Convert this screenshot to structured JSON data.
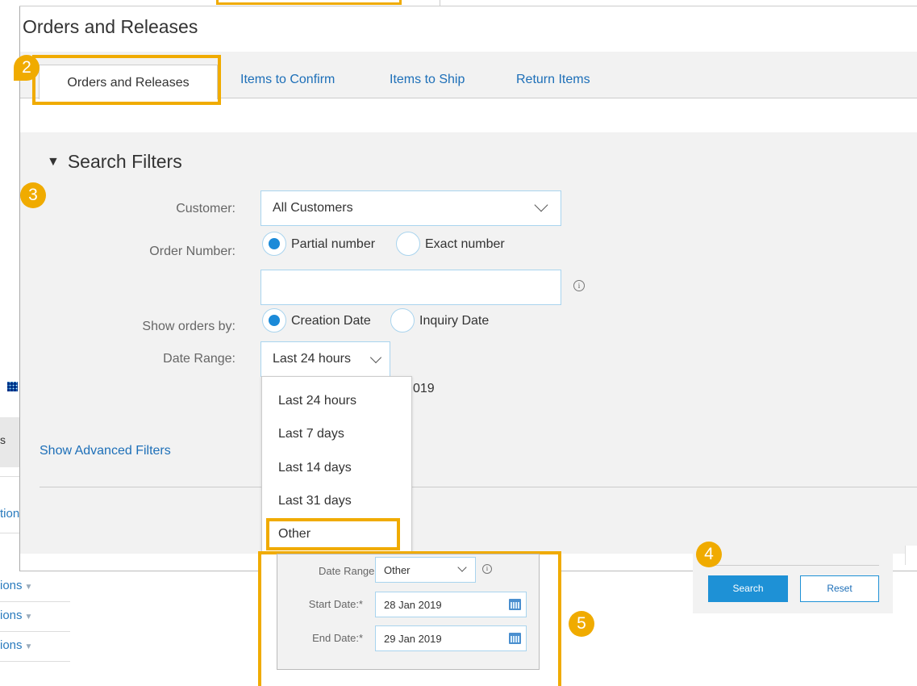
{
  "window": {
    "title": "Orders and Releases"
  },
  "tabs": [
    {
      "label": "Orders and Releases",
      "active": true
    },
    {
      "label": "Items to Confirm",
      "active": false
    },
    {
      "label": "Items to Ship",
      "active": false
    },
    {
      "label": "Return Items",
      "active": false
    }
  ],
  "filters": {
    "heading": "Search Filters",
    "customer_label": "Customer:",
    "customer_value": "All Customers",
    "order_number_label": "Order Number:",
    "order_number_options": [
      "Partial number",
      "Exact number"
    ],
    "order_number_selected": "Partial number",
    "order_number_value": "",
    "show_orders_label": "Show orders by:",
    "show_orders_options": [
      "Creation Date",
      "Inquiry Date"
    ],
    "show_orders_selected": "Creation Date",
    "date_range_label": "Date Range:",
    "date_range_value": "Last 24 hours",
    "partial_text": "019",
    "date_range_options": [
      "Last 24 hours",
      "Last 7 days",
      "Last 14 days",
      "Last 31 days",
      "Other"
    ],
    "show_advanced": "Show Advanced Filters"
  },
  "date_panel": {
    "range_label": "Date Range:",
    "range_value": "Other",
    "start_label": "Start Date:*",
    "start_value": "28 Jan 2019",
    "end_label": "End Date:*",
    "end_value": "29 Jan 2019"
  },
  "actions": {
    "search": "Search",
    "reset": "Reset"
  },
  "background": {
    "tab_fragment": "s",
    "row_fragment": "tions",
    "action_links": [
      "ions",
      "ions",
      "ions"
    ]
  },
  "badges": [
    "2",
    "3",
    "4",
    "5"
  ],
  "colors": {
    "highlight": "#f0ab00",
    "link": "#1d6fb8",
    "primary": "#1e91d6"
  }
}
